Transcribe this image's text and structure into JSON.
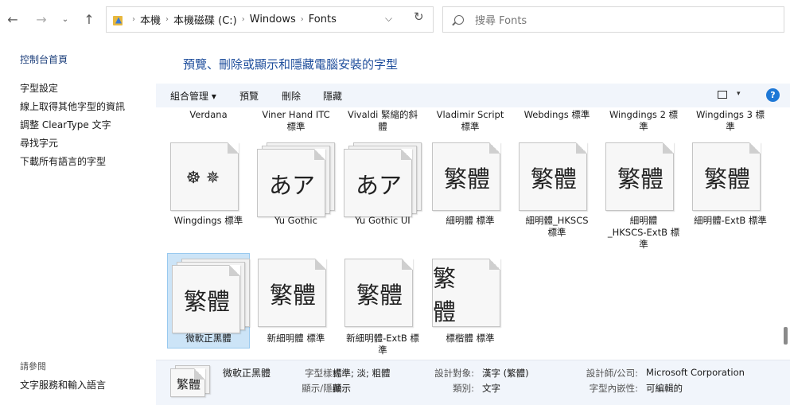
{
  "address": {
    "crumbs": [
      "本機",
      "本機磁碟 (C:)",
      "Windows",
      "Fonts"
    ],
    "search_placeholder": "搜尋 Fonts"
  },
  "left_pane": {
    "home": "控制台首頁",
    "links": [
      "字型設定",
      "線上取得其他字型的資訊",
      "調整 ClearType 文字",
      "尋找字元",
      "下載所有語言的字型"
    ],
    "see_also_label": "請參閱",
    "see_also_links": [
      "文字服務和輸入語言"
    ]
  },
  "main": {
    "title": "預覽、刪除或顯示和隱藏電腦安裝的字型",
    "toolbar": {
      "organize": "組合管理 ▾",
      "preview": "預覽",
      "delete": "刪除",
      "hide": "隱藏",
      "help": "?"
    }
  },
  "top_row_names": [
    [
      "Verdana"
    ],
    [
      "Viner Hand ITC",
      "標準"
    ],
    [
      "Vivaldi 緊縮的斜",
      "體"
    ],
    [
      "Vladimir Script",
      "標準"
    ],
    [
      "Webdings 標準"
    ],
    [
      "Wingdings 2 標",
      "準"
    ],
    [
      "Wingdings 3 標",
      "準"
    ]
  ],
  "fonts": [
    {
      "preview": "☸✵",
      "lines": [
        "Wingdings 標準"
      ],
      "stack": false
    },
    {
      "preview": "あア",
      "lines": [
        "Yu Gothic"
      ],
      "stack": true
    },
    {
      "preview": "あア",
      "lines": [
        "Yu Gothic UI"
      ],
      "stack": true
    },
    {
      "preview": "繁體",
      "lines": [
        "細明體 標準"
      ],
      "stack": false
    },
    {
      "preview": "繁體",
      "lines": [
        "細明體_HKSCS",
        "標準"
      ],
      "stack": false
    },
    {
      "preview": "繁體",
      "lines": [
        "細明體",
        "_HKSCS-ExtB 標",
        "準"
      ],
      "stack": false
    },
    {
      "preview": "繁體",
      "lines": [
        "細明體-ExtB 標準"
      ],
      "stack": false
    },
    {
      "preview": "繁體",
      "lines": [
        "微軟正黑體"
      ],
      "stack": true,
      "selected": true
    },
    {
      "preview": "繁體",
      "lines": [
        "新細明體 標準"
      ],
      "stack": false
    },
    {
      "preview": "繁體",
      "lines": [
        "新細明體-ExtB 標",
        "準"
      ],
      "stack": false
    },
    {
      "preview": "繁 體",
      "lines": [
        "標楷體 標準"
      ],
      "stack": false
    }
  ],
  "details": {
    "preview": "繁體",
    "name": "微軟正黑體",
    "style_label": "字型樣式:",
    "style_value": "標準; 淡; 粗體",
    "show_hide_label": "顯示/隱藏:",
    "show_hide_value": "顯示",
    "designed_for_label": "設計對象:",
    "designed_for_value": "漢字 (繁體)",
    "category_label": "類別:",
    "category_value": "文字",
    "designer_label": "設計師/公司:",
    "designer_value": "Microsoft Corporation",
    "embeddability_label": "字型內嵌性:",
    "embeddability_value": "可編輯的"
  },
  "colors": {
    "accent_title": "#1f4e9c",
    "selection": "#cce4f7",
    "help": "#1e78d6"
  }
}
